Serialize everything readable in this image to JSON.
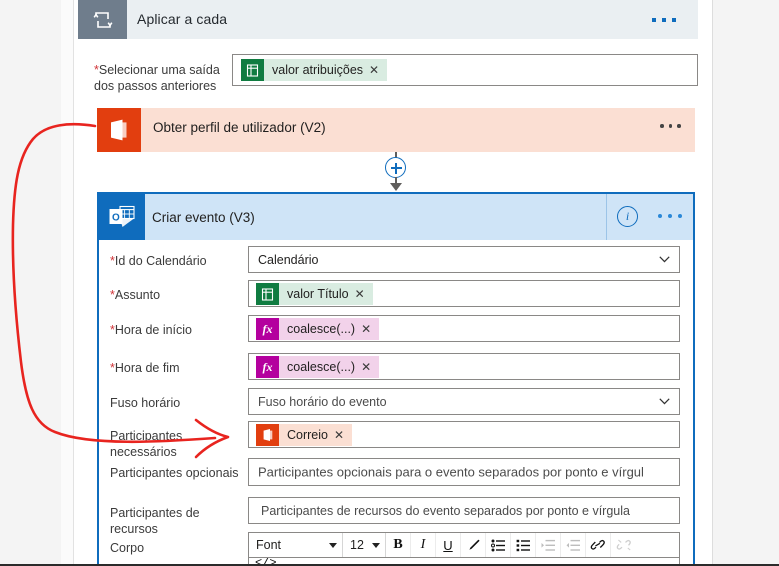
{
  "loop_card": {
    "title": "Aplicar a cada",
    "icon": "loop-repeat-icon",
    "overflow": "…",
    "field": {
      "label_line1": "Selecionar uma saída",
      "label_line2": "dos passos anteriores",
      "required": "*",
      "token": {
        "text": "valor atribuições",
        "remove": "✕",
        "icon": "planner-icon",
        "color": "#107c41"
      }
    }
  },
  "user_card": {
    "title": "Obter perfil de utilizador (V2)",
    "icon": "office365-users-icon",
    "overflow": "…",
    "color": "#e23e0f",
    "background": "#fbdfd3"
  },
  "connector": {
    "add_label": "+",
    "icon": "add-step-icon"
  },
  "event_card": {
    "title": "Criar evento (V3)",
    "icon": "outlook-calendar-icon",
    "info": "i",
    "overflow": "…",
    "accent": "#0f6cbd",
    "header_background": "#cfe4f7",
    "fields": [
      {
        "label": "Id do Calendário",
        "required": "*",
        "type": "select",
        "value": "Calendário"
      },
      {
        "label": "Assunto",
        "required": "*",
        "type": "token",
        "token": {
          "text": "valor Título",
          "remove": "✕",
          "icon": "planner-icon",
          "style": "green"
        }
      },
      {
        "label": "Hora de início",
        "required": "*",
        "type": "token",
        "token": {
          "text": "coalesce(...)",
          "remove": "✕",
          "icon": "function-fx-icon",
          "style": "pink"
        }
      },
      {
        "label": "Hora de fim",
        "required": "*",
        "type": "token",
        "token": {
          "text": "coalesce(...)",
          "remove": "✕",
          "icon": "function-fx-icon",
          "style": "pink"
        }
      },
      {
        "label": "Fuso horário",
        "required": "",
        "type": "select",
        "value": "Fuso horário do evento"
      },
      {
        "label": "Participantes",
        "label2": "necessários",
        "required": "",
        "type": "token",
        "token": {
          "text": "Correio",
          "remove": "✕",
          "icon": "office365-users-icon",
          "style": "peach"
        }
      },
      {
        "label": "Participantes opcionais",
        "required": "",
        "type": "input",
        "placeholder": "Participantes opcionais para o evento separados por ponto e vírgul"
      },
      {
        "label": "Participantes de",
        "label2": "recursos",
        "required": "",
        "type": "input",
        "placeholder": "Participantes de recursos do evento separados por ponto e vírgula"
      },
      {
        "label": "Corpo",
        "required": "",
        "type": "richtext"
      }
    ]
  },
  "richtext_toolbar": {
    "font_name": "Font",
    "font_size": "12",
    "buttons": [
      {
        "name": "bold-icon",
        "glyph": "B"
      },
      {
        "name": "italic-icon",
        "glyph": "I"
      },
      {
        "name": "underline-icon",
        "glyph": "U"
      },
      {
        "name": "text-color-pen-icon",
        "glyph": "✎"
      },
      {
        "name": "bulleted-list-icon",
        "glyph": "☰"
      },
      {
        "name": "numbered-list-icon",
        "glyph": "☰"
      },
      {
        "name": "increase-indent-icon",
        "glyph": "☰"
      },
      {
        "name": "decrease-indent-icon",
        "glyph": "☰"
      },
      {
        "name": "insert-link-icon",
        "glyph": "🔗"
      },
      {
        "name": "remove-link-icon",
        "glyph": "🔗"
      }
    ],
    "code_view": "</>"
  },
  "annotation": {
    "type": "hand-drawn-arrow",
    "color": "#e8241f",
    "description": "Seta vermelha de Obter perfil de utilizador (V2) para Participantes necessários"
  }
}
